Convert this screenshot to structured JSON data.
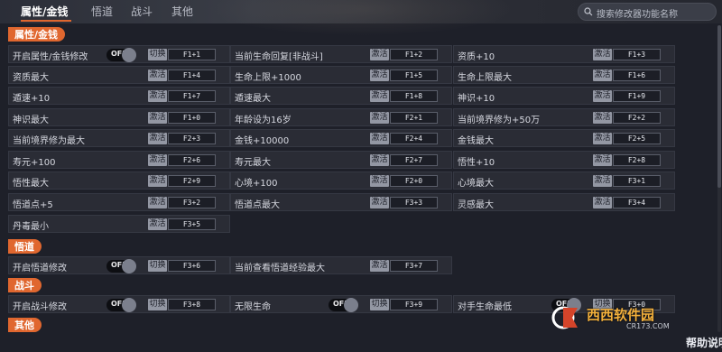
{
  "tabs": [
    {
      "label": "属性/金钱",
      "active": true
    },
    {
      "label": "悟道",
      "active": false
    },
    {
      "label": "战斗",
      "active": false
    },
    {
      "label": "其他",
      "active": false
    }
  ],
  "search": {
    "placeholder": "搜索修改器功能名称"
  },
  "sections": [
    {
      "title": "属性/金钱"
    },
    {
      "title": "悟道"
    },
    {
      "title": "战斗"
    },
    {
      "title": "其他"
    }
  ],
  "toggle_label": "OFF",
  "btn_activate": "激活",
  "btn_switch": "切换",
  "rows": [
    {
      "label": "开启属性/金钱修改",
      "action": "切换",
      "hotkey": "F1+1",
      "toggle": true
    },
    {
      "label": "当前生命回复[非战斗]",
      "action": "激活",
      "hotkey": "F1+2"
    },
    {
      "label": "资质+10",
      "action": "激活",
      "hotkey": "F1+3"
    },
    {
      "label": "资质最大",
      "action": "激活",
      "hotkey": "F1+4"
    },
    {
      "label": "生命上限+1000",
      "action": "激活",
      "hotkey": "F1+5"
    },
    {
      "label": "生命上限最大",
      "action": "激活",
      "hotkey": "F1+6"
    },
    {
      "label": "遁速+10",
      "action": "激活",
      "hotkey": "F1+7"
    },
    {
      "label": "遁速最大",
      "action": "激活",
      "hotkey": "F1+8"
    },
    {
      "label": "神识+10",
      "action": "激活",
      "hotkey": "F1+9"
    },
    {
      "label": "神识最大",
      "action": "激活",
      "hotkey": "F1+0"
    },
    {
      "label": "年龄设为16岁",
      "action": "激活",
      "hotkey": "F2+1"
    },
    {
      "label": "当前境界修为+50万",
      "action": "激活",
      "hotkey": "F2+2"
    },
    {
      "label": "当前境界修为最大",
      "action": "激活",
      "hotkey": "F2+3"
    },
    {
      "label": "金钱+10000",
      "action": "激活",
      "hotkey": "F2+4"
    },
    {
      "label": "金钱最大",
      "action": "激活",
      "hotkey": "F2+5"
    },
    {
      "label": "寿元+100",
      "action": "激活",
      "hotkey": "F2+6"
    },
    {
      "label": "寿元最大",
      "action": "激活",
      "hotkey": "F2+7"
    },
    {
      "label": "悟性+10",
      "action": "激活",
      "hotkey": "F2+8"
    },
    {
      "label": "悟性最大",
      "action": "激活",
      "hotkey": "F2+9"
    },
    {
      "label": "心境+100",
      "action": "激活",
      "hotkey": "F2+0"
    },
    {
      "label": "心境最大",
      "action": "激活",
      "hotkey": "F3+1"
    },
    {
      "label": "悟道点+5",
      "action": "激活",
      "hotkey": "F3+2"
    },
    {
      "label": "悟道点最大",
      "action": "激活",
      "hotkey": "F3+3"
    },
    {
      "label": "灵感最大",
      "action": "激活",
      "hotkey": "F3+4"
    },
    {
      "label": "丹毒最小",
      "action": "激活",
      "hotkey": "F3+5"
    },
    {
      "label": "开启悟道修改",
      "action": "切换",
      "hotkey": "F3+6",
      "toggle": true
    },
    {
      "label": "当前查看悟道经验最大",
      "action": "激活",
      "hotkey": "F3+7"
    },
    {
      "label": "开启战斗修改",
      "action": "切换",
      "hotkey": "F3+8",
      "toggle": true
    },
    {
      "label": "无限生命",
      "action": "切换",
      "hotkey": "F3+9",
      "toggle": true
    },
    {
      "label": "对手生命最低",
      "action": "切换",
      "hotkey": "F3+0",
      "toggle": true
    }
  ],
  "watermark": {
    "site": "西西软件园",
    "domain": "CR173.COM"
  },
  "help": {
    "label": "帮助说明"
  }
}
